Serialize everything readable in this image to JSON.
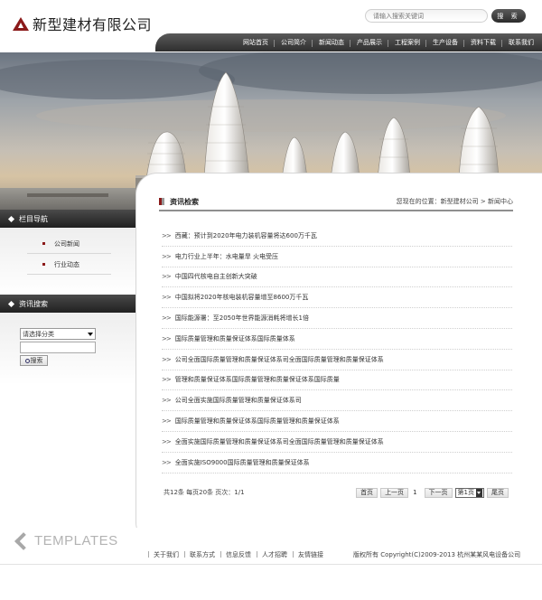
{
  "site": {
    "name": "新型建材有限公司",
    "brand_color": "#8b1a1a"
  },
  "search": {
    "placeholder": "请输入搜索关键词",
    "button_label": "搜 索"
  },
  "nav": {
    "items": [
      "网站首页",
      "公司简介",
      "新闻动态",
      "产品展示",
      "工程案例",
      "生产设备",
      "资料下载",
      "联系我们"
    ]
  },
  "sidebar": {
    "nav_title": "栏目导航",
    "nav_items": [
      "公司新闻",
      "行业动态"
    ],
    "search_title": "资讯搜索",
    "category_select": "请选择分类",
    "search_button": "搜索"
  },
  "main": {
    "section_title": "资讯检索",
    "breadcrumb": "您现在的位置：新型建材公司 > 新闻中心",
    "news": [
      "西藏：预计到2020年电力装机容量将达600万千瓦",
      "电力行业上半年：水电量旱 火电受压",
      "中国四代核电自主创新大突破",
      "中国拟将2020年核电装机容量增至8600万千瓦",
      "国际能源署：至2050年世界能源消耗将增长1倍",
      "国际质量管理和质量保证体系国际质量体系",
      "公司全面国际质量管理和质量保证体系司全面国际质量管理和质量保证体系",
      "管理和质量保证体系国际质量管理和质量保证体系国际质量",
      "公司全面实施国际质量管理和质量保证体系司",
      "国际质量管理和质量保证体系国际质量管理和质量保证体系",
      "全面实施国际质量管理和质量保证体系司全面国际质量管理和质量保证体系",
      "全面实施ISO9000国际质量管理和质量保证体系"
    ],
    "pager": {
      "info": "共12条  每页20条  页次：1/1",
      "first": "首页",
      "prev": "上一页",
      "current": "1",
      "next": "下一页",
      "select": "第1页",
      "last": "尾页"
    }
  },
  "footer": {
    "templates_label": "TEMPLATES",
    "links": [
      "关于我们",
      "联系方式",
      "信息反馈",
      "人才招聘",
      "友情链接"
    ],
    "copyright": "版权所有  Copyright(C)2009-2013 杭州某某风电设备公司"
  }
}
